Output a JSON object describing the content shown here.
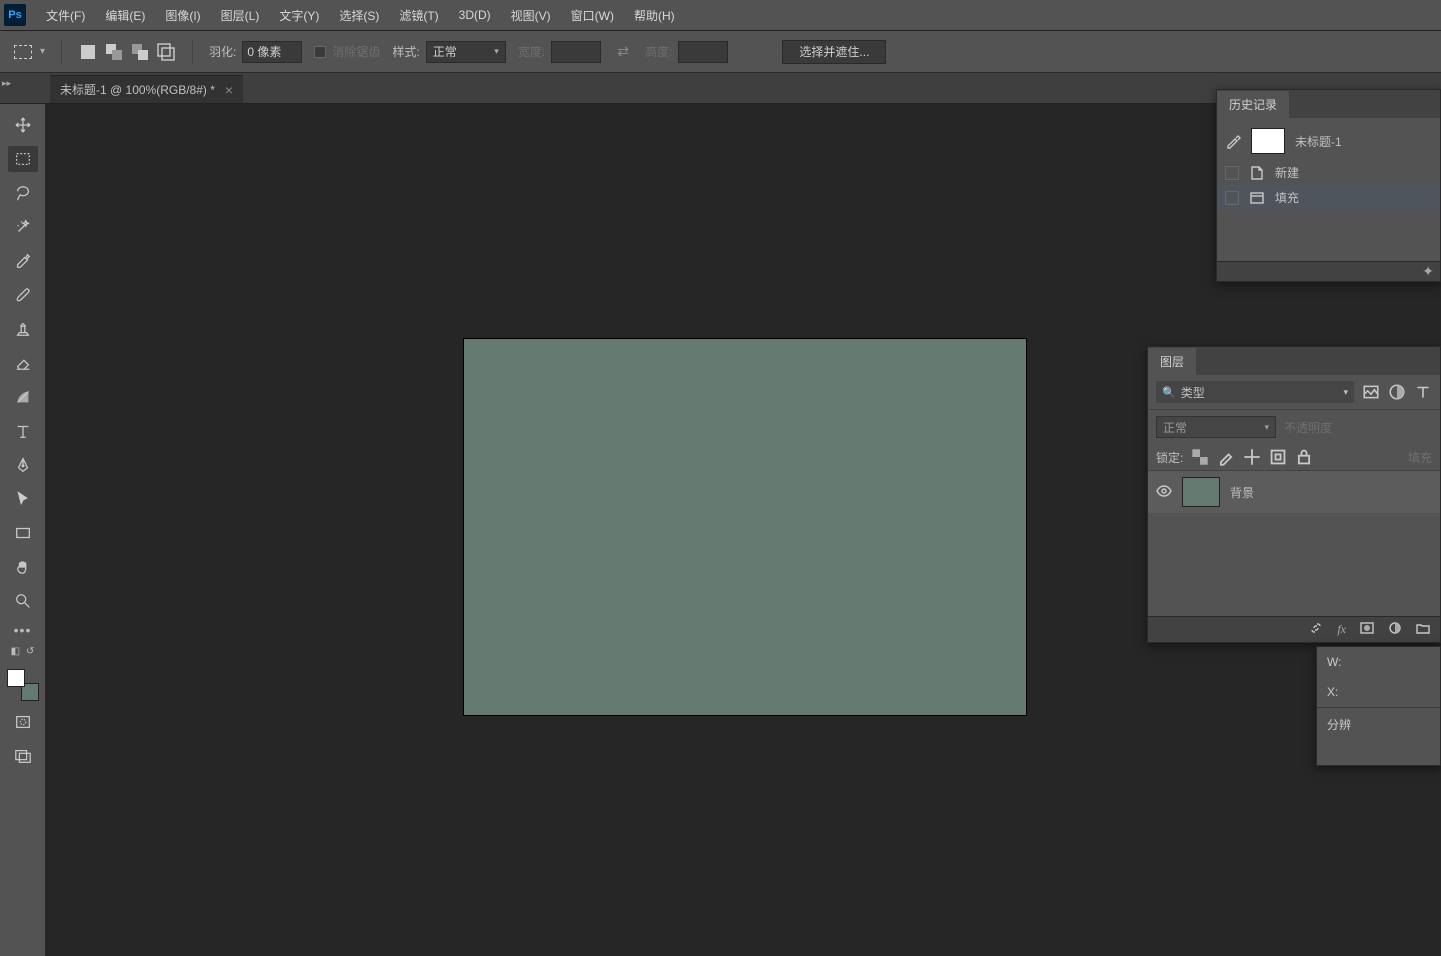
{
  "app": {
    "logo_text": "Ps"
  },
  "menu": {
    "file": "文件(F)",
    "edit": "编辑(E)",
    "image": "图像(I)",
    "layer": "图层(L)",
    "type": "文字(Y)",
    "select": "选择(S)",
    "filter": "滤镜(T)",
    "threeD": "3D(D)",
    "view": "视图(V)",
    "window": "窗口(W)",
    "help": "帮助(H)"
  },
  "options": {
    "feather_label": "羽化:",
    "feather_value": "0 像素",
    "antialias_label": "消除锯齿",
    "style_label": "样式:",
    "style_value": "正常",
    "width_label": "宽度:",
    "width_value": "",
    "height_label": "高度:",
    "height_value": "",
    "select_mask_button": "选择并遮住..."
  },
  "document": {
    "tab_title": "未标题-1 @ 100%(RGB/8#) *"
  },
  "history": {
    "panel_title": "历史记录",
    "doc_name": "未标题-1",
    "steps": [
      {
        "label": "新建"
      },
      {
        "label": "填充"
      }
    ]
  },
  "layers": {
    "panel_title": "图层",
    "filter_label": "类型",
    "blend_mode": "正常",
    "opacity_label": "不透明度",
    "lock_label": "锁定:",
    "fill_label": "填充",
    "layer_name": "背景"
  },
  "info": {
    "w_label": "W:",
    "x_label": "X:",
    "res_label": "分辨"
  },
  "colors": {
    "canvas_fill": "#647a70"
  }
}
